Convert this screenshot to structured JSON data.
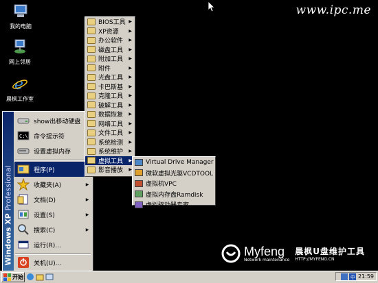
{
  "watermark": "www.ipc.me",
  "desktop_icons": [
    {
      "label": "我的电脑",
      "icon": "my-computer-icon"
    },
    {
      "label": "网上邻居",
      "icon": "network-icon"
    },
    {
      "label": "晨枫工作室",
      "icon": "internet-explorer-icon"
    }
  ],
  "start_menu": {
    "banner_bold": "Windows XP",
    "banner_light": "Professional",
    "items": [
      {
        "label": "show出移动硬盘",
        "icon": "drive-icon",
        "arrow": ""
      },
      {
        "label": "命令提示符",
        "icon": "command-prompt-icon",
        "arrow": ""
      },
      {
        "label": "设置虚拟内存",
        "icon": "memory-icon",
        "arrow": ""
      },
      {
        "label": "程序(P)",
        "icon": "programs-icon",
        "arrow": "▶"
      },
      {
        "label": "收藏夹(A)",
        "icon": "favorites-icon",
        "arrow": "▶"
      },
      {
        "label": "文档(D)",
        "icon": "documents-icon",
        "arrow": "▶"
      },
      {
        "label": "设置(S)",
        "icon": "settings-icon",
        "arrow": "▶"
      },
      {
        "label": "搜索(C)",
        "icon": "search-icon",
        "arrow": "▶"
      },
      {
        "label": "运行(R)...",
        "icon": "run-icon",
        "arrow": ""
      },
      {
        "label": "关机(U)...",
        "icon": "shutdown-icon",
        "arrow": ""
      }
    ]
  },
  "programs_menu": [
    "BIOS工具",
    "XP资源",
    "办公软件",
    "磁盘工具",
    "附加工具",
    "附件",
    "光盘工具",
    "卡巴斯基",
    "克隆工具",
    "破解工具",
    "数据恢复",
    "网络工具",
    "文件工具",
    "系统检测",
    "系统维护",
    "虚拟工具",
    "影音播放"
  ],
  "virtual_tools_menu": [
    {
      "label": "Virtual Drive Manager",
      "icon": "virtual-drive-icon"
    },
    {
      "label": "微软虚拟光驱VCDTOOL",
      "icon": "cd-icon"
    },
    {
      "label": "虚拟机VPC",
      "icon": "vpc-icon"
    },
    {
      "label": "虚拟内存盘Ramdisk",
      "icon": "ramdisk-icon"
    },
    {
      "label": "虚拟驱动器专家",
      "icon": "drive-expert-icon"
    }
  ],
  "taskbar": {
    "start_label": "开始",
    "clock": "21:59"
  },
  "brand_logo": {
    "name": "Myfeng",
    "tagline": "Network maintenance",
    "title": "晨枫U盘维护工具",
    "url": "HTTP://MYFENG.CN"
  },
  "colors": {
    "desktop": "#000000",
    "menu_bg": "#d4d0c8",
    "highlight": "#0a246a"
  }
}
